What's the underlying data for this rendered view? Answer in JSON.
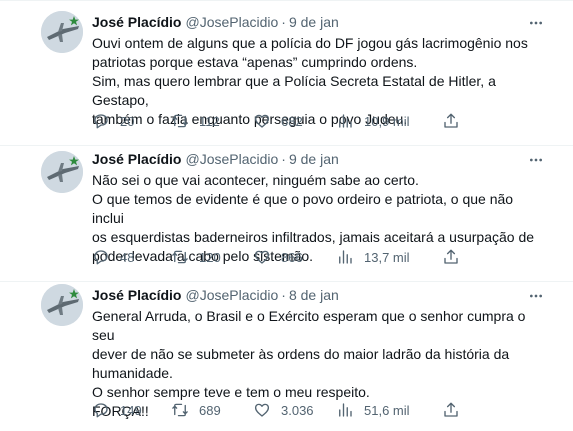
{
  "tweets": [
    {
      "author_name": "José Placídio",
      "handle": "@JosePlacidio",
      "separator": "·",
      "date": "9 de jan",
      "text": "Ouvi ontem de alguns que a polícia do DF jogou gás lacrimogênio nos\npatriotas porque estava “apenas” cumprindo ordens.\nSim, mas quero lembrar que a Polícia Secreta Estatal de Hitler, a Gestapo,\ntambém o fazia enquanto perseguia o povo Judeu.",
      "replies": "20",
      "retweets": "112",
      "likes": "682",
      "views": "10,9 mil"
    },
    {
      "author_name": "José Placídio",
      "handle": "@JosePlacidio",
      "separator": "·",
      "date": "9 de jan",
      "text": "Não sei o que vai acontecer, ninguém sabe ao certo.\nO que temos de evidente é que o povo ordeiro e patriota, o que não inclui\nos esquerdistas baderneiros infiltrados, jamais aceitará a usurpação de\npoder levada a cabo pelo sistemão.",
      "replies": "48",
      "retweets": "120",
      "likes": "866",
      "views": "13,7 mil"
    },
    {
      "author_name": "José Placídio",
      "handle": "@JosePlacidio",
      "separator": "·",
      "date": "8 de jan",
      "text": "General Arruda, o Brasil e o Exército esperam que o senhor cumpra o seu\ndever de não se submeter às ordens do maior ladrão da história da\nhumanidade.\nO senhor sempre teve e tem o meu respeito.\nFORÇA!!",
      "replies": "149",
      "retweets": "689",
      "likes": "3.036",
      "views": "51,6 mil"
    }
  ],
  "icons": {
    "reply": "reply-icon",
    "retweet": "retweet-icon",
    "like": "heart-icon",
    "views": "views-icon",
    "share": "share-icon",
    "more": "more-icon"
  },
  "colors": {
    "text": "#0f1419",
    "secondary": "#536471",
    "divider": "#eff3f4"
  }
}
